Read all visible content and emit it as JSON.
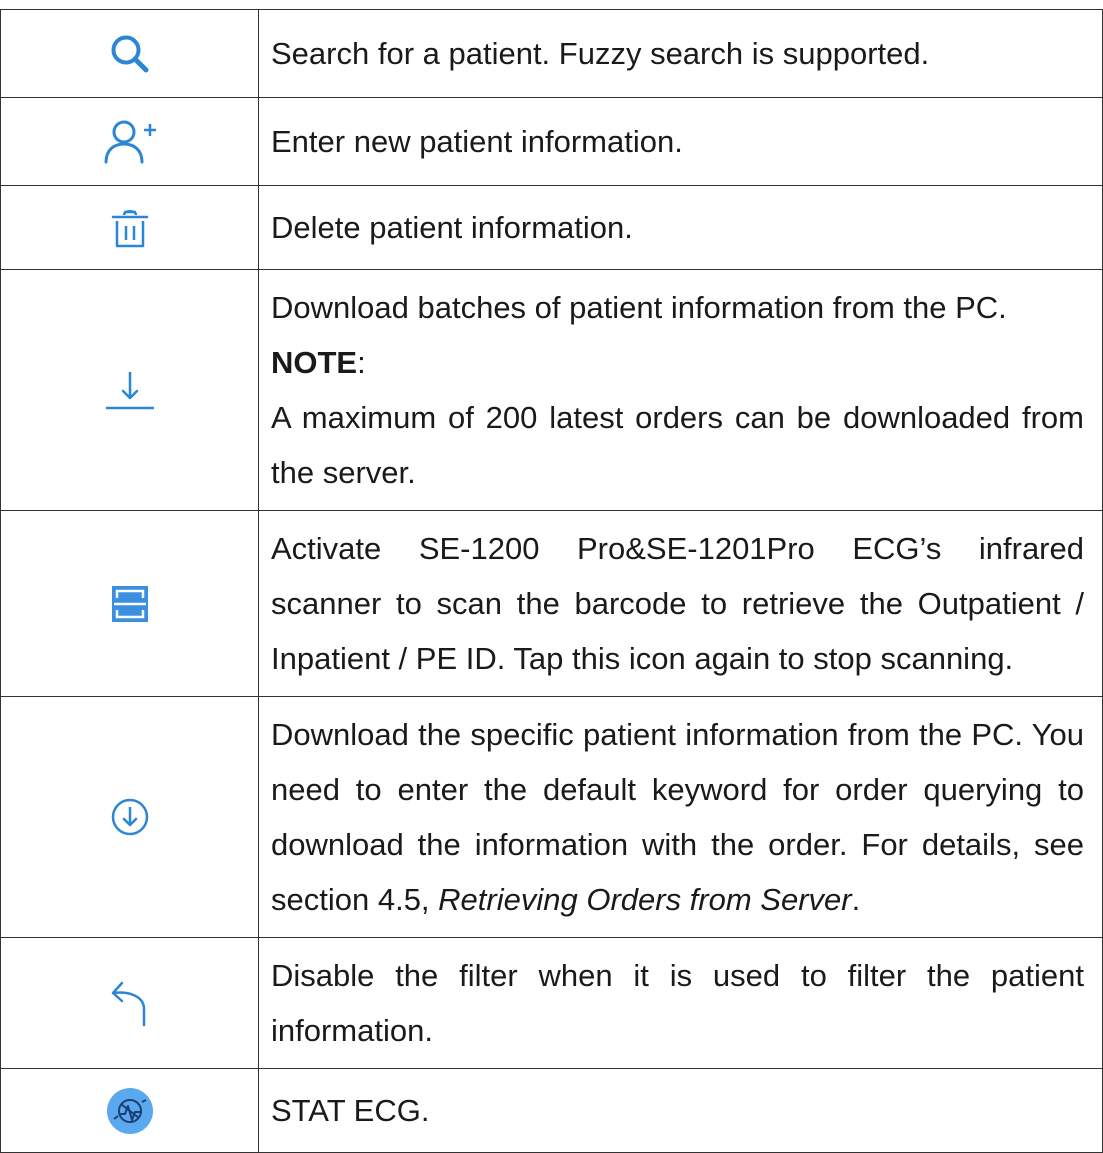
{
  "rows": [
    {
      "icon": "search-icon",
      "text": "Search for a patient. Fuzzy search is supported."
    },
    {
      "icon": "add-user-icon",
      "text": "Enter new patient information."
    },
    {
      "icon": "trash-icon",
      "text": "Delete patient information."
    },
    {
      "icon": "download-icon",
      "text": "Download batches of patient information from the PC.",
      "note_label": "NOTE",
      "note_colon": ":",
      "note_text": "A maximum of 200 latest orders can be downloaded from the server."
    },
    {
      "icon": "scan-icon",
      "text": "Activate SE-1200 Pro&SE-1201Pro ECG’s infrared scanner to scan the barcode to retrieve the Outpatient / Inpatient / PE ID. Tap this icon again to stop scanning."
    },
    {
      "icon": "download-circle-icon",
      "text_before": "Download the specific patient information from the PC. You need to enter the default keyword for order querying to download the information with the order. For details, see section 4.5, ",
      "text_link": "Retrieving Orders from Server",
      "text_after": "."
    },
    {
      "icon": "undo-arrow-icon",
      "text": "Disable the filter when it is used to filter the patient information."
    },
    {
      "icon": "stat-ecg-icon",
      "text": "STAT ECG."
    }
  ],
  "colors": {
    "icon_blue": "#2b86d6",
    "icon_fill_blue": "#3a8fe0",
    "border": "#333333",
    "text": "#1a1a1a"
  }
}
